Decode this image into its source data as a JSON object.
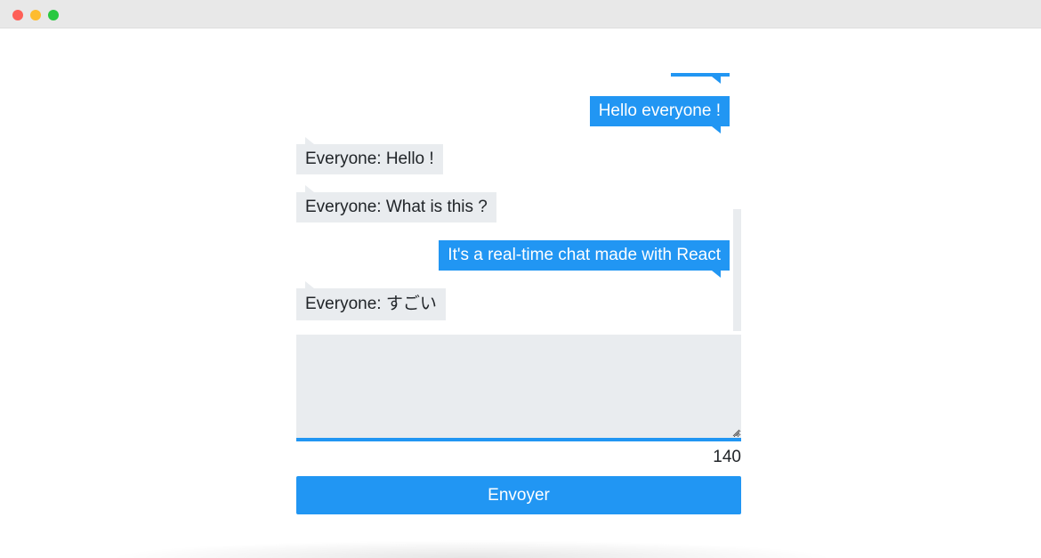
{
  "window": {
    "controls": [
      "close",
      "minimize",
      "maximize"
    ]
  },
  "chat": {
    "messages": [
      {
        "type": "sent",
        "text": "Hello everyone !"
      },
      {
        "type": "received",
        "text": "Everyone: Hello !"
      },
      {
        "type": "received",
        "text": "Everyone: What is this ?"
      },
      {
        "type": "sent",
        "text": "It's a real-time chat made with React"
      },
      {
        "type": "received",
        "text": "Everyone: すごい"
      }
    ]
  },
  "composer": {
    "value": "",
    "remaining_chars": "140"
  },
  "actions": {
    "send_label": "Envoyer"
  },
  "colors": {
    "accent": "#2196f3",
    "bubble_received": "#e9ecef",
    "text": "#212529"
  }
}
